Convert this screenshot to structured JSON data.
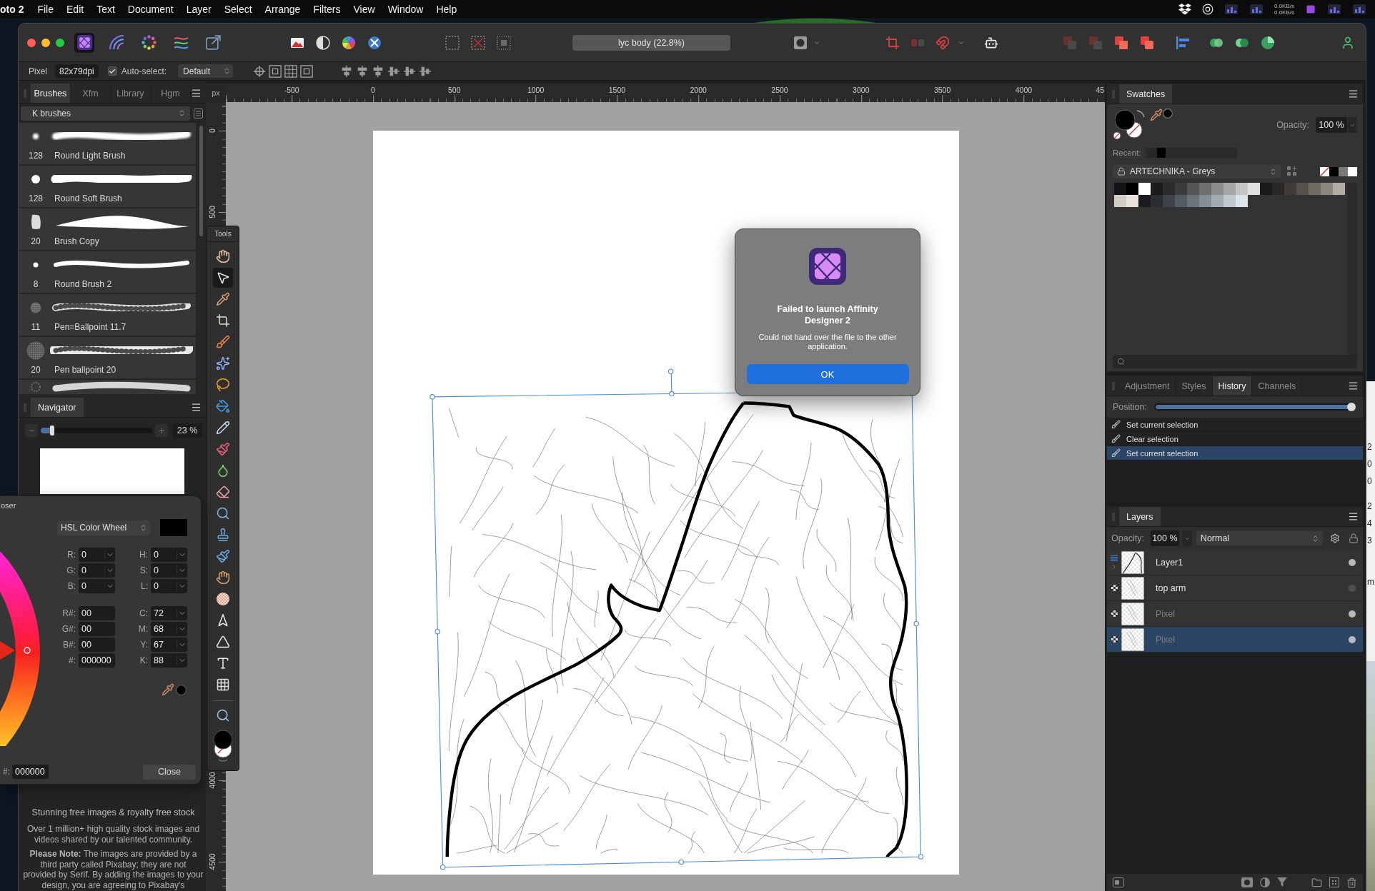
{
  "menu_bar": {
    "app_name": "oto 2",
    "items": [
      "File",
      "Edit",
      "Text",
      "Document",
      "Layer",
      "Select",
      "Arrange",
      "Filters",
      "View",
      "Window",
      "Help"
    ],
    "network_speeds": [
      "0.0KB/s",
      "0.0KB/s"
    ]
  },
  "toolbar": {
    "personas": [
      {
        "kind": "photo",
        "selected": true
      },
      {
        "kind": "liquify",
        "selected": false
      },
      {
        "kind": "develop",
        "selected": false
      },
      {
        "kind": "tone_mapping",
        "selected": false
      },
      {
        "kind": "export",
        "selected": false
      }
    ],
    "document_title": "lyc body (22.8%)"
  },
  "context_toolbar": {
    "tool": "Pixel",
    "resolution": "82x79dpi",
    "auto_select": {
      "label": "Auto-select:",
      "checked": true
    },
    "mode": "Default"
  },
  "brushes_panel": {
    "tabs": [
      {
        "label": "Brushes",
        "selected": true
      },
      {
        "label": "Xfm",
        "selected": false
      },
      {
        "label": "Library",
        "selected": false
      },
      {
        "label": "Hgm",
        "selected": false
      }
    ],
    "category": "K brushes",
    "brushes": [
      {
        "kind": "soft",
        "size": "128",
        "name": "Round Light Brush"
      },
      {
        "kind": "round",
        "size": "128",
        "name": "Round Soft Brush"
      },
      {
        "kind": "taper",
        "size": "20",
        "name": "Brush Copy"
      },
      {
        "kind": "fine",
        "size": "8",
        "name": "Round Brush 2"
      },
      {
        "kind": "textured",
        "size": "11",
        "name": "Pen=Ballpoint 11.7"
      },
      {
        "kind": "rough",
        "size": "20",
        "name": "Pen ballpoint 20"
      },
      {
        "kind": "speckled"
      }
    ]
  },
  "navigator": {
    "title": "Navigator",
    "zoom": {
      "level": 0.1,
      "value": "23 %"
    }
  },
  "stock_panel": {
    "heading": "Stunning free images & royalty free stock",
    "description": "Over 1 million+ high quality stock images and videos shared by our talented community.",
    "note": "**Please Note:** The images are provided by a third party called Pixabay; they are not provided by Serif. By adding the images to your design, you are agreeing to Pixabay's"
  },
  "tools_panel": {
    "title": "Tools",
    "tools": [
      {
        "kind": "hand",
        "selected": false
      },
      {
        "kind": "move",
        "selected": true
      },
      {
        "kind": "color-picker",
        "selected": false
      },
      {
        "kind": "crop",
        "selected": false
      },
      {
        "kind": "selection-brush",
        "selected": false
      },
      {
        "kind": "magic-wand",
        "selected": false
      },
      {
        "kind": "lasso",
        "selected": false
      },
      {
        "kind": "flood-fill",
        "selected": false
      },
      {
        "kind": "inpainting",
        "selected": false
      },
      {
        "kind": "paint-brush",
        "selected": false
      },
      {
        "kind": "color-replace",
        "selected": false
      },
      {
        "kind": "eraser",
        "selected": false
      },
      {
        "kind": "dodge",
        "selected": false
      },
      {
        "kind": "clone",
        "selected": false
      },
      {
        "kind": "undo-brush",
        "selected": false
      },
      {
        "kind": "smudge",
        "selected": false
      },
      {
        "kind": "blur",
        "selected": false
      },
      {
        "kind": "node",
        "selected": false
      },
      {
        "kind": "shape",
        "selected": false
      },
      {
        "kind": "text",
        "selected": false
      },
      {
        "kind": "mesh",
        "selected": false
      }
    ],
    "view_tools": [
      {
        "kind": "zoom",
        "selected": false
      }
    ]
  },
  "color_chooser": {
    "title": "oser",
    "model": "HSL Color Wheel",
    "blocks": [
      [
        {
          "label": "R:",
          "value": "0",
          "kind": "spin"
        },
        {
          "label": "H:",
          "value": "0",
          "kind": "spin"
        },
        {
          "label": "G:",
          "value": "0",
          "kind": "spin"
        },
        {
          "label": "S:",
          "value": "0",
          "kind": "spin"
        },
        {
          "label": "B:",
          "value": "0",
          "kind": "spin"
        },
        {
          "label": "L:",
          "value": "0",
          "kind": "spin"
        }
      ],
      [
        {
          "label": "R#:",
          "value": "00",
          "kind": "plain"
        },
        {
          "label": "C:",
          "value": "72",
          "kind": "spin"
        },
        {
          "label": "G#:",
          "value": "00",
          "kind": "plain"
        },
        {
          "label": "M:",
          "value": "68",
          "kind": "spin"
        },
        {
          "label": "B#:",
          "value": "00",
          "kind": "plain"
        },
        {
          "label": "Y:",
          "value": "67",
          "kind": "spin"
        },
        {
          "label": "#:",
          "value": "000000",
          "kind": "plain"
        },
        {
          "label": "K:",
          "value": "88",
          "kind": "spin"
        }
      ]
    ],
    "hex": {
      "label": "#:",
      "value": "000000"
    },
    "close": "Close"
  },
  "canvas": {
    "unit": "px",
    "h_ruler": [
      "-500",
      "0",
      "500",
      "1000",
      "1500",
      "2000",
      "2500",
      "3000",
      "3500",
      "4000",
      "45"
    ],
    "v_ruler": [
      "0",
      "500",
      "4000",
      "4500"
    ]
  },
  "dialog": {
    "title": "Failed to launch Affinity Designer 2",
    "message": "Could not hand over the file to the other application.",
    "button": "OK"
  },
  "swatches_panel": {
    "title": "Swatches",
    "opacity_label": "Opacity:",
    "opacity": "100 %",
    "recent_label": "Recent:",
    "recent": [
      {
        "color": "#2a2724"
      },
      {
        "color": "#000000"
      }
    ],
    "palette": "ARTECHNIKA - Greys",
    "quick_swatches": [
      {
        "kind": "none"
      },
      {
        "kind": "fill",
        "color": "#000000"
      },
      {
        "kind": "fill",
        "color": "#7a7a7a"
      },
      {
        "kind": "fill",
        "color": "#ffffff"
      }
    ],
    "swatches": [
      {
        "color": "#141418"
      },
      {
        "color": "#000000"
      },
      {
        "color": "#ffffff"
      },
      {
        "color": "#1b1b1b"
      },
      {
        "color": "#2b2b2b"
      },
      {
        "color": "#3c3c3c"
      },
      {
        "color": "#565656"
      },
      {
        "color": "#6f6f6f"
      },
      {
        "color": "#8b8b8b"
      },
      {
        "color": "#a6a6a6"
      },
      {
        "color": "#c5c5c5"
      },
      {
        "color": "#e1e1e1"
      },
      {
        "color": "#1c1a18"
      },
      {
        "color": "#2a2825"
      },
      {
        "color": "#3f3c38"
      },
      {
        "color": "#55524d"
      },
      {
        "color": "#6e6a64"
      },
      {
        "color": "#8c8880"
      },
      {
        "color": "#b1aca4"
      },
      {
        "color": "#d3cec7"
      },
      {
        "color": "#e9e2d8"
      },
      {
        "color": "#1a1c1e"
      },
      {
        "color": "#2a2e31"
      },
      {
        "color": "#3d4349"
      },
      {
        "color": "#535a61"
      },
      {
        "color": "#6b737a"
      },
      {
        "color": "#868e95"
      },
      {
        "color": "#a3abb2"
      },
      {
        "color": "#c0c7ce"
      },
      {
        "color": "#dde4eb"
      }
    ]
  },
  "history_panel": {
    "tabs": [
      {
        "label": "Adjustment",
        "selected": false
      },
      {
        "label": "Styles",
        "selected": false
      },
      {
        "label": "History",
        "selected": true
      },
      {
        "label": "Channels",
        "selected": false
      }
    ],
    "position": {
      "label": "Position:",
      "level": 1
    },
    "entries": [
      {
        "label": "Set current selection",
        "selected": false
      },
      {
        "label": "Clear selection",
        "selected": false
      },
      {
        "label": "Set current selection",
        "selected": true
      }
    ]
  },
  "layers_panel": {
    "title": "Layers",
    "opacity_label": "Opacity:",
    "opacity": "100 %",
    "blend_mode": "Normal",
    "layers": [
      {
        "kind": "group",
        "name": "Layer1",
        "expanded": false,
        "visible": true,
        "dimmed": false,
        "selected": false
      },
      {
        "kind": "pixel",
        "name": "top arm",
        "visible": false,
        "dimmed": false,
        "selected": false
      },
      {
        "kind": "pixel",
        "name": "Pixel",
        "visible": true,
        "dimmed": true,
        "selected": false
      },
      {
        "kind": "pixel",
        "name": "Pixel",
        "visible": true,
        "dimmed": true,
        "selected": true
      }
    ]
  },
  "background_window": {
    "fragments": [
      "2",
      "0",
      "0",
      "2",
      "4",
      "3",
      "m"
    ]
  }
}
